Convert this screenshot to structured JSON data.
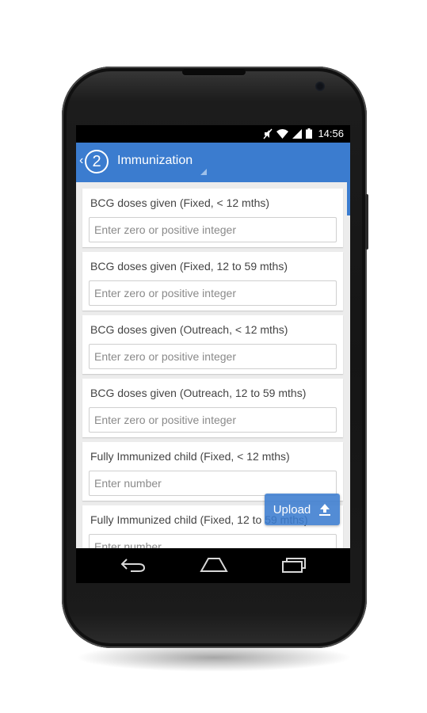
{
  "status_bar": {
    "time": "14:56",
    "icons": [
      "mute-icon",
      "wifi-icon",
      "signal-icon",
      "battery-icon"
    ]
  },
  "app_bar": {
    "back_glyph": "‹",
    "step_number": "2",
    "title": "Immunization"
  },
  "fields": [
    {
      "label": "BCG doses given (Fixed, < 12 mths)",
      "placeholder": "Enter zero or positive integer",
      "value": ""
    },
    {
      "label": "BCG doses given (Fixed, 12 to 59 mths)",
      "placeholder": "Enter zero or positive integer",
      "value": ""
    },
    {
      "label": "BCG doses given (Outreach, < 12 mths)",
      "placeholder": "Enter zero or positive integer",
      "value": ""
    },
    {
      "label": "BCG doses given (Outreach, 12 to 59 mths)",
      "placeholder": "Enter zero or positive integer",
      "value": ""
    },
    {
      "label": "Fully Immunized child (Fixed, < 12 mths)",
      "placeholder": "Enter number",
      "value": ""
    },
    {
      "label": "Fully Immunized child (Fixed, 12 to 59 mths)",
      "placeholder": "Enter number",
      "value": ""
    }
  ],
  "upload_button": {
    "label": "Upload",
    "icon": "upload-icon"
  },
  "nav_bar": {
    "icons": [
      "back-icon",
      "home-icon",
      "recents-icon"
    ]
  },
  "colors": {
    "accent": "#3b7ccf",
    "background": "#ececec",
    "card": "#ffffff"
  }
}
